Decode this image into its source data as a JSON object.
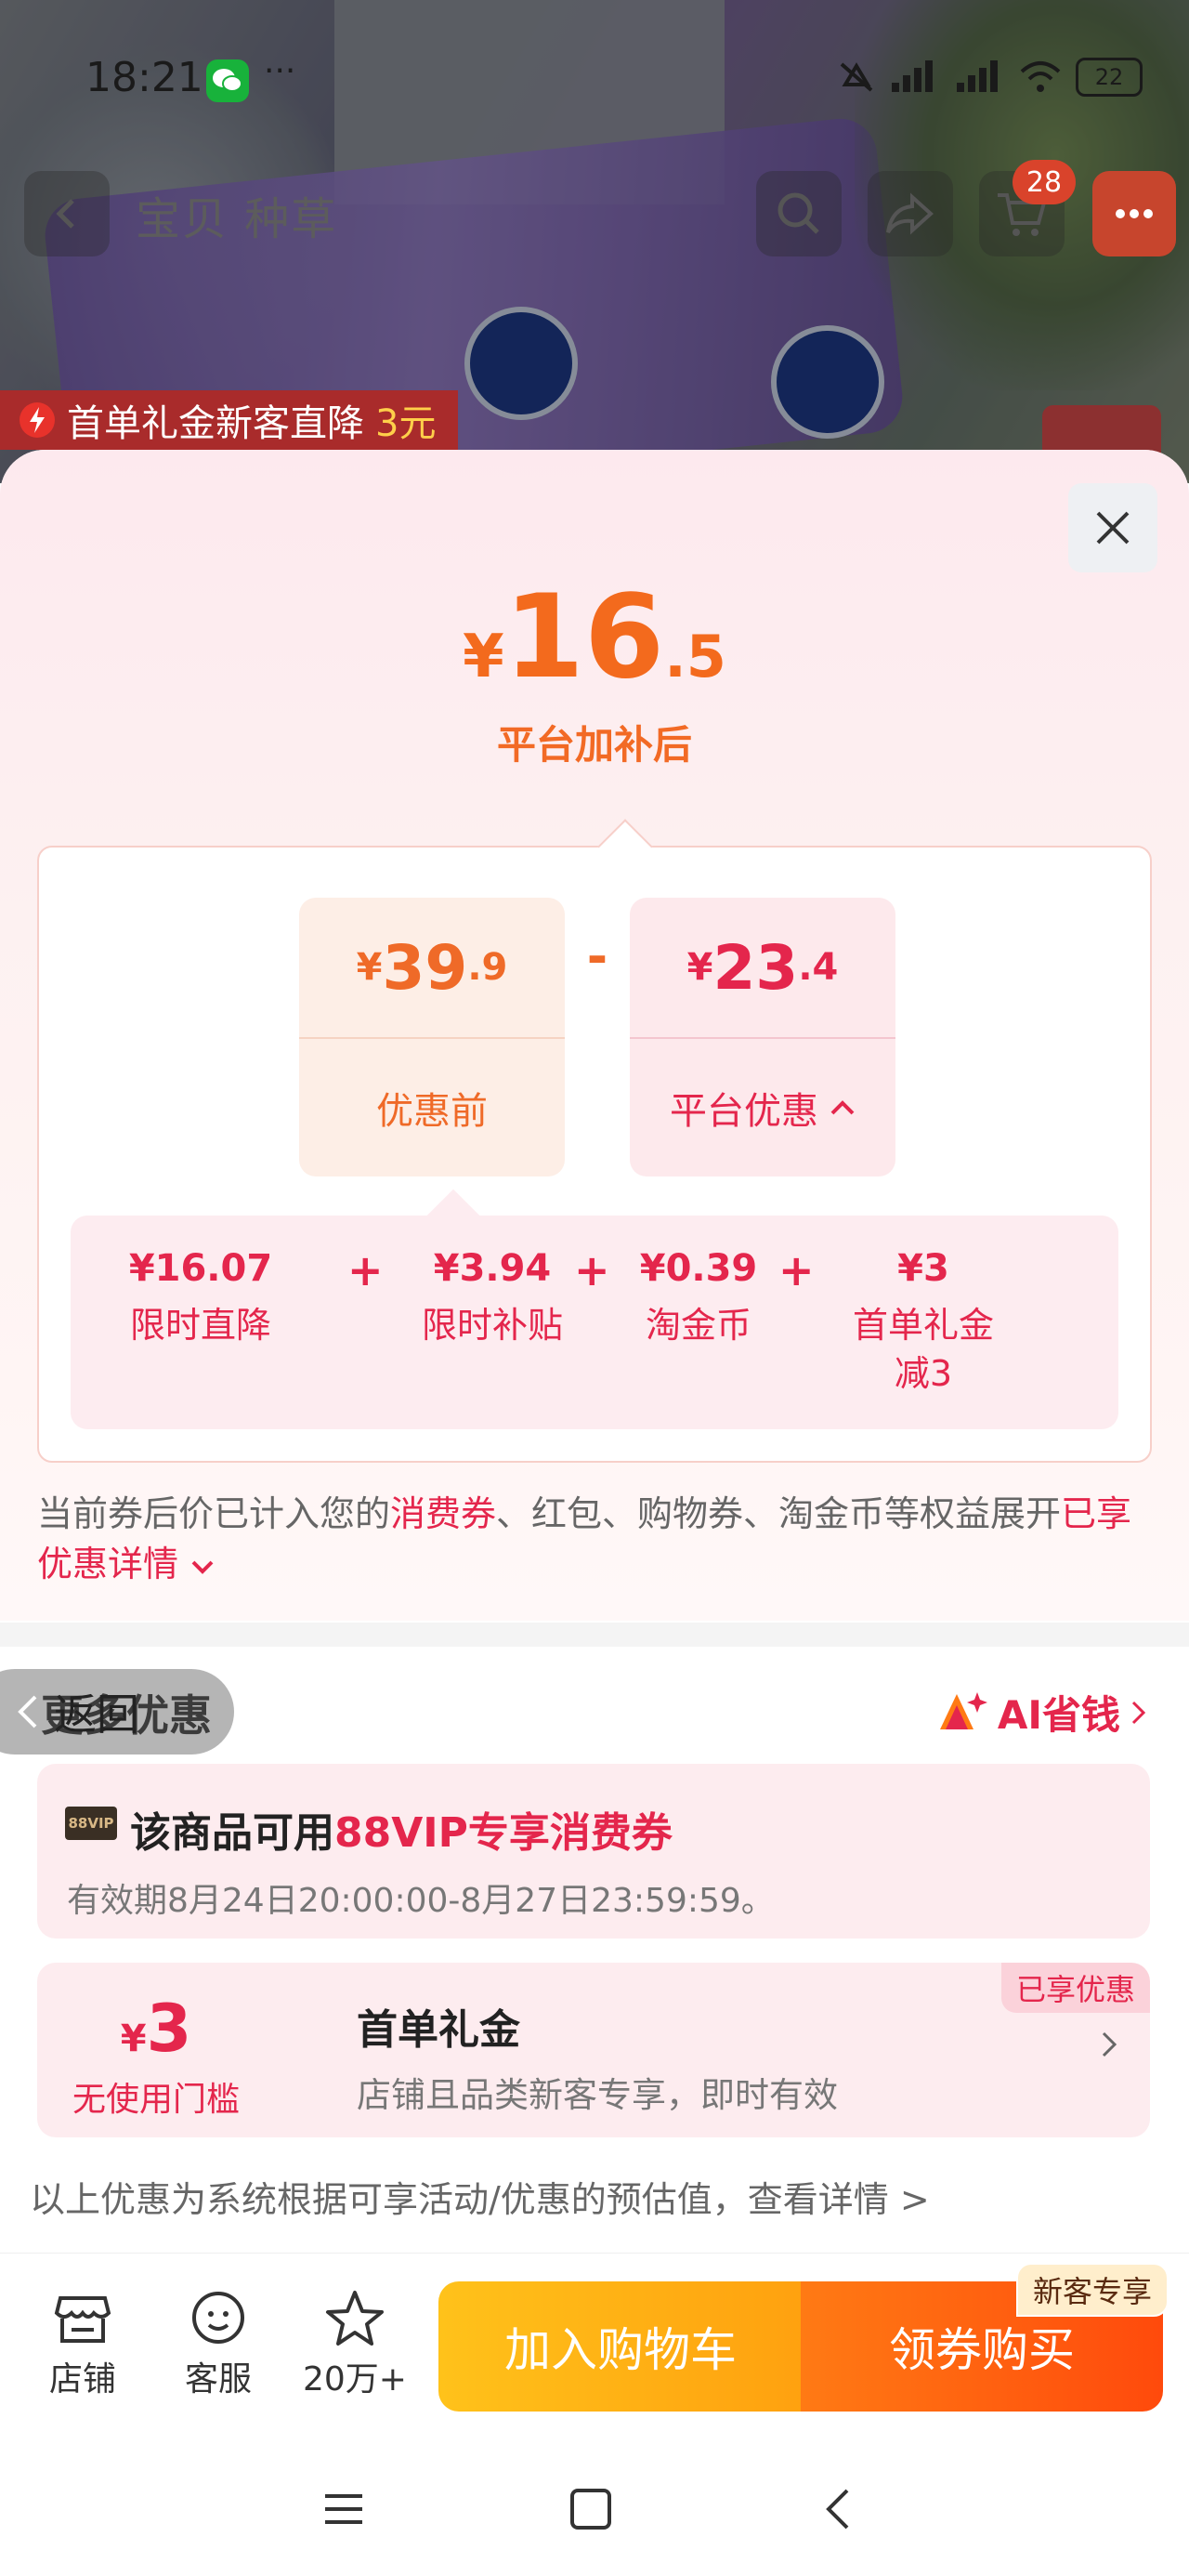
{
  "status_bar": {
    "time": "18:21",
    "dots": "···",
    "battery": "22"
  },
  "nav": {
    "tabs": "宝贝  种草",
    "cart_count": "28"
  },
  "banner": {
    "text": "首单礼金新客直降",
    "amount": "3元"
  },
  "sheet": {
    "final_price": {
      "yen": "¥",
      "int": "16",
      "dec": ".5"
    },
    "final_caption": "平台加补后",
    "before": {
      "yen": "¥",
      "int": "39",
      "dec": ".9",
      "label": "优惠前"
    },
    "minus": "-",
    "discount": {
      "yen": "¥",
      "int": "23",
      "dec": ".4",
      "label": "平台优惠"
    },
    "breakdown": [
      {
        "value": "¥16.07",
        "label": "限时直降",
        "sub": ""
      },
      {
        "value": "¥3.94",
        "label": "限时补贴",
        "sub": ""
      },
      {
        "value": "¥0.39",
        "label": "淘金币",
        "sub": ""
      },
      {
        "value": "¥3",
        "label": "首单礼金",
        "sub": "减3"
      }
    ],
    "plus": "+",
    "info": {
      "part1": "当前券后价已计入您的",
      "highlight1": "消费券",
      "part2": "、红包、购物券、淘金币等权益展开",
      "highlight2": "已享优惠详情"
    },
    "more_offers_title": "更多优惠",
    "back_label": "返回",
    "ai_save": "AI省钱",
    "vip": {
      "badge": "88VIP",
      "title_prefix": "该商品可用",
      "title_highlight": "88VIP专享消费券",
      "validity": "有效期8月24日20:00:00-8月27日23:59:59。"
    },
    "coupon": {
      "yen": "¥",
      "amount": "3",
      "threshold": "无使用门槛",
      "title": "首单礼金",
      "desc": "店铺且品类新客专享，即时有效",
      "tag": "已享优惠"
    },
    "disclaimer": "以上优惠为系统根据可享活动/优惠的预估值，查看详情 >"
  },
  "bottom_bar": {
    "shop": "店铺",
    "service": "客服",
    "favorites": "20万+",
    "add_cart": "加入购物车",
    "coupon_buy": "领券购买",
    "newcomer_tag": "新客专享"
  },
  "colors": {
    "accent_orange": "#f36a1d",
    "accent_red": "#e4264c",
    "cta_yellow": "#ffc21a",
    "cta_orange": "#ff4a0c"
  }
}
